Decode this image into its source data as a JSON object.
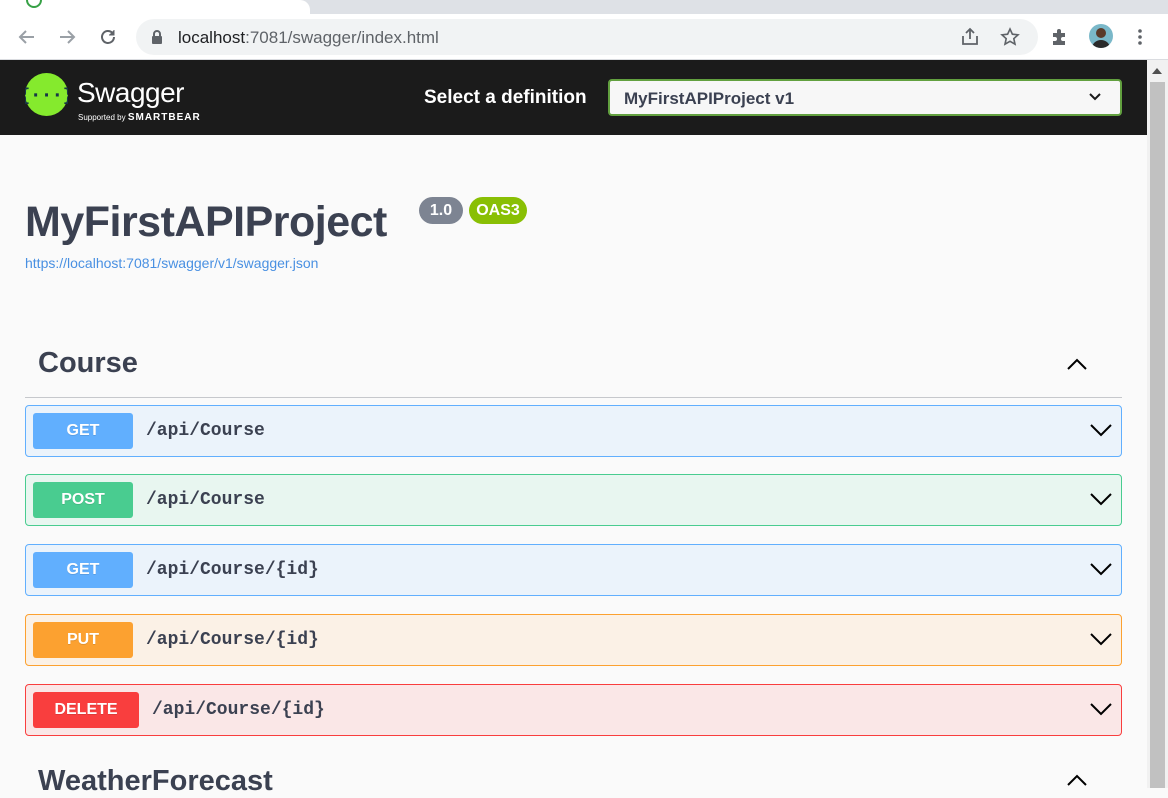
{
  "browser": {
    "url_host": "localhost",
    "url_path": ":7081/swagger/index.html"
  },
  "swagger": {
    "logo_text": "Swagger",
    "supported_by": "Supported by",
    "smartbear": "SMARTBEAR",
    "select_label": "Select a definition",
    "selected_definition": "MyFirstAPIProject v1"
  },
  "info": {
    "title": "MyFirstAPIProject",
    "version": "1.0",
    "oas": "OAS3",
    "spec_url": "https://localhost:7081/swagger/v1/swagger.json"
  },
  "sections": [
    {
      "name": "Course",
      "operations": [
        {
          "method": "GET",
          "path": "/api/Course"
        },
        {
          "method": "POST",
          "path": "/api/Course"
        },
        {
          "method": "GET",
          "path": "/api/Course/{id}"
        },
        {
          "method": "PUT",
          "path": "/api/Course/{id}"
        },
        {
          "method": "DELETE",
          "path": "/api/Course/{id}"
        }
      ]
    },
    {
      "name": "WeatherForecast",
      "operations": []
    }
  ],
  "colors": {
    "get": "#61affe",
    "post": "#49cc90",
    "put": "#fca130",
    "delete": "#f93e3e",
    "swagger_green": "#85ea2d",
    "topbar": "#1b1b1b"
  }
}
